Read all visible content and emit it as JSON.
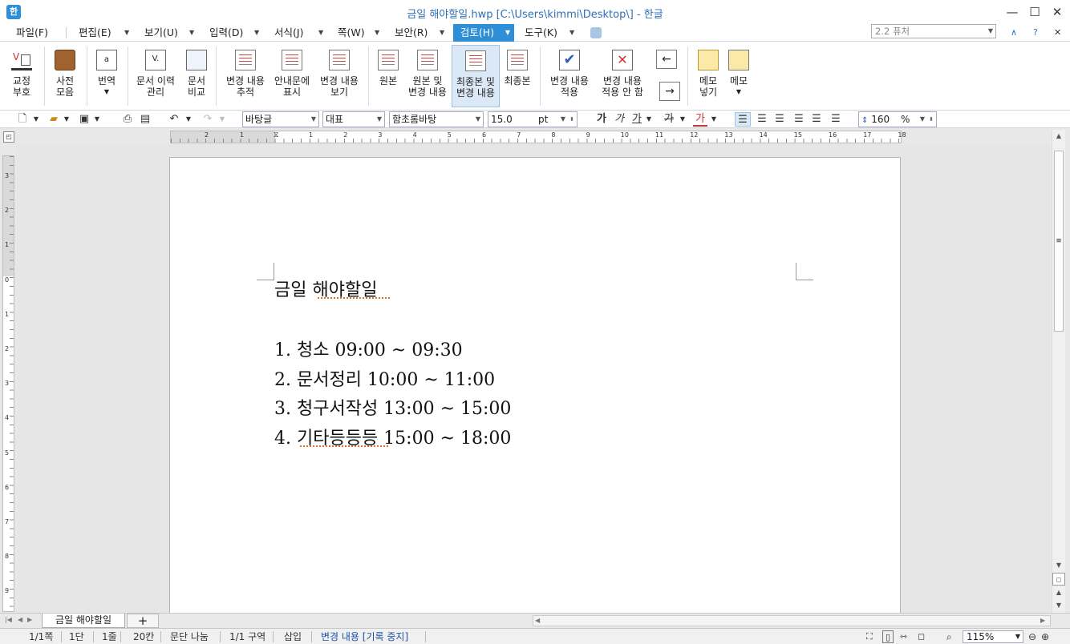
{
  "window": {
    "title": "금일 해야할일.hwp [C:\\Users\\kimmi\\Desktop\\] - 한글",
    "app_icon": "한",
    "minimize": "—",
    "maximize": "☐",
    "close": "✕"
  },
  "menu": {
    "items": [
      "파일(F)",
      "편집(E)",
      "보기(U)",
      "입력(D)",
      "서식(J)",
      "쪽(W)",
      "보안(R)",
      "검토(H)",
      "도구(K)"
    ],
    "active": "검토(H)",
    "style_box": "2.2 퓨처",
    "help": "?",
    "collapse": "∧",
    "close_doc": "✕"
  },
  "ribbon": {
    "proofread": "교정\n부호",
    "dictionary": "사전\n모음",
    "translate": "번역",
    "doc_history": "문서 이력\n관리",
    "doc_compare": "문서\n비교",
    "track_changes": "변경 내용\n추적",
    "show_guide": "안내문에\n표시",
    "view_changes": "변경 내용\n보기",
    "original": "원본",
    "original_and_changes": "원본 및\n변경 내용",
    "final_and_changes": "최종본 및\n변경 내용",
    "final": "최종본",
    "accept_changes": "변경 내용\n적용",
    "reject_changes": "변경 내용\n적용 안 함",
    "insert_memo": "메모\n넣기",
    "memo": "메모"
  },
  "format": {
    "style": "바탕글",
    "lang": "대표",
    "font": "함초롬바탕",
    "size": "15.0",
    "unit": "pt",
    "bold": "가",
    "italic": "가",
    "underline": "가",
    "strike": "가",
    "color": "가",
    "line_spacing": "160",
    "percent": "%"
  },
  "ruler": {
    "h_labels": [
      "2",
      "1",
      "1",
      "2",
      "3",
      "4",
      "5",
      "6",
      "7",
      "8",
      "9",
      "10",
      "11",
      "12",
      "13",
      "14",
      "15",
      "16",
      "17",
      "18"
    ],
    "v_labels": [
      "3",
      "2",
      "1",
      "0",
      "1",
      "2",
      "3",
      "4",
      "5",
      "6",
      "7",
      "8",
      "9"
    ]
  },
  "document": {
    "title": "금일 해야할일",
    "lines": [
      "1. 청소 09:00 ~ 09:30",
      "2. 문서정리 10:00 ~ 11:00",
      "3. 청구서작성 13:00 ~ 15:00",
      "4. 기타등등등 15:00 ~ 18:00"
    ]
  },
  "tabs": {
    "doc_tab": "금일 해야할일",
    "add": "+"
  },
  "status": {
    "page": "1/1쪽",
    "column": "1단",
    "line": "1줄",
    "col_pos": "20칸",
    "para_break": "문단 나눔",
    "section": "1/1 구역",
    "insert_mode": "삽입",
    "track": "변경 내용 [기록 중지]",
    "zoom": "115%"
  }
}
